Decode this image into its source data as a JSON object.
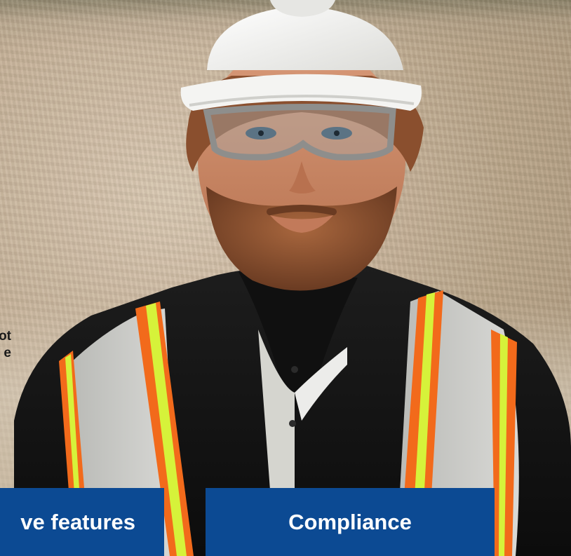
{
  "hero": {
    "image_alt": "Worker wearing a white hard hat, safety glasses and a high-visibility vest in a quarry",
    "side_text_lines": [
      "ot",
      "e"
    ]
  },
  "tiles": [
    {
      "label": "ve features"
    },
    {
      "label": "Compliance"
    }
  ],
  "colors": {
    "tile_blue": "#0c4a93",
    "tile_text": "#ffffff",
    "vest_orange": "#f26a1b",
    "vest_yellow": "#d6f23a",
    "vest_reflective": "#c9c9c7",
    "shirt_black": "#151515",
    "hard_hat": "#f4f4f2"
  },
  "icons": {
    "hero_image": "construction-worker-photo"
  }
}
